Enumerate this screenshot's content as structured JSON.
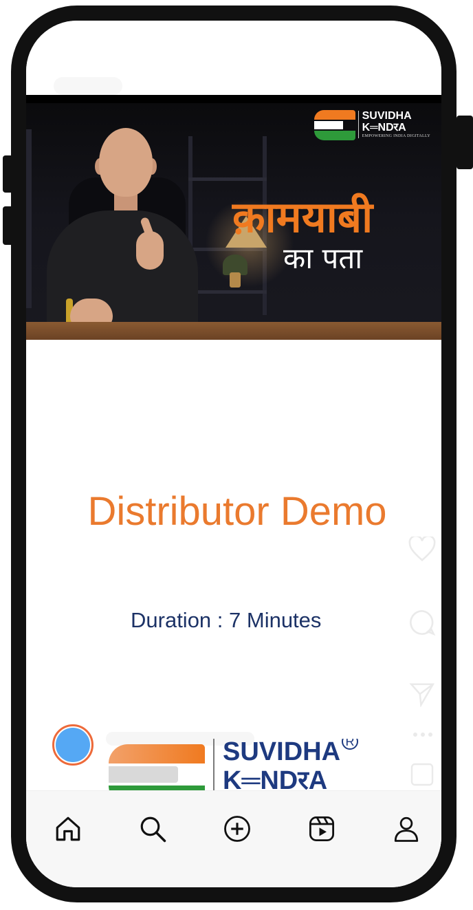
{
  "post": {
    "banner": {
      "logo_line1": "SUVIDHA",
      "logo_line2": "K═NDरA",
      "logo_tagline": "EMPOWERING INDIA DIGITALLY",
      "headline_hindi": "क़ामयाबी",
      "subheadline_hindi": "का पता"
    },
    "title": "Distributor Demo",
    "duration": "Duration : 7 Minutes",
    "brand_logo": {
      "line1": "SUVIDHA",
      "line2": "K═NDरA",
      "registered": "R"
    }
  },
  "colors": {
    "title": "#ea7a2e",
    "duration": "#1c3266",
    "avatar_ring": "#ed6a3a",
    "avatar_fill": "#55a8f4",
    "brand_blue": "#1e3a80",
    "brand_orange": "#f07a20",
    "brand_green": "#2e9a3a"
  },
  "bottom_nav": {
    "items": [
      {
        "name": "home",
        "icon": "home-icon"
      },
      {
        "name": "search",
        "icon": "search-icon"
      },
      {
        "name": "create",
        "icon": "add-post-icon"
      },
      {
        "name": "reels",
        "icon": "reels-icon"
      },
      {
        "name": "profile",
        "icon": "profile-icon"
      }
    ]
  },
  "action_icons": [
    "like-icon",
    "comment-icon",
    "share-icon",
    "more-icon",
    "save-icon"
  ]
}
